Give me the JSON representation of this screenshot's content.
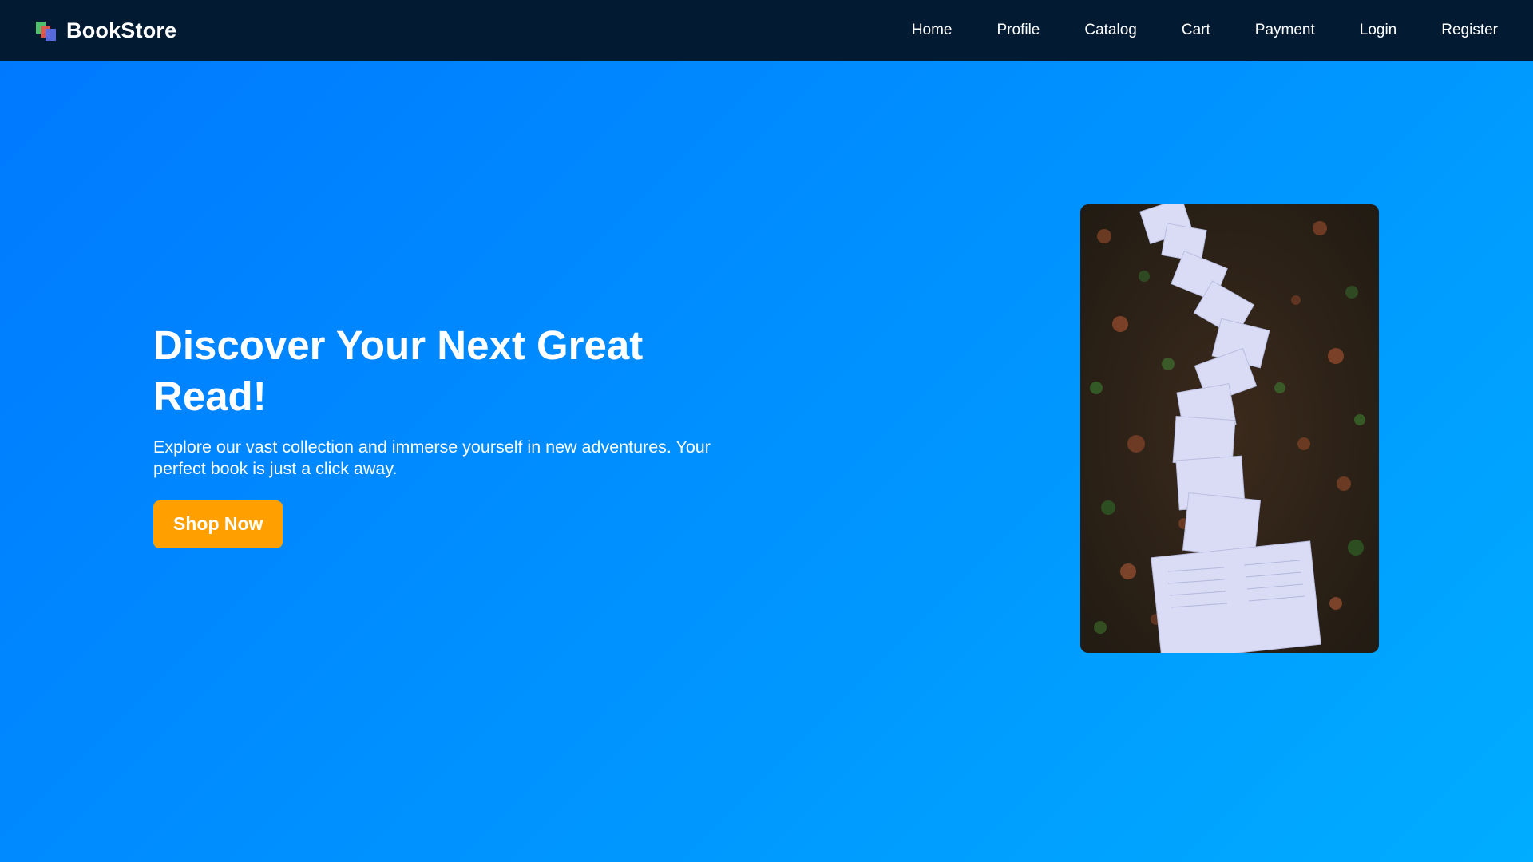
{
  "nav": {
    "brand": "BookStore",
    "logo_icon": "books-stack-icon",
    "links": [
      "Home",
      "Profile",
      "Catalog",
      "Cart",
      "Payment",
      "Login",
      "Register"
    ]
  },
  "hero": {
    "title": "Discover Your Next Great Read!",
    "subtitle": "Explore our vast collection and immerse yourself in new adventures. Your perfect book is just a click away.",
    "cta_label": "Shop Now",
    "image_alt": "Open books laid in a winding path on leaf-covered ground"
  },
  "colors": {
    "nav_bg": "#031a33",
    "hero_gradient_start": "#0079ff",
    "hero_gradient_end": "#00adff",
    "cta_bg": "#ffa000",
    "text": "#ffffff"
  }
}
